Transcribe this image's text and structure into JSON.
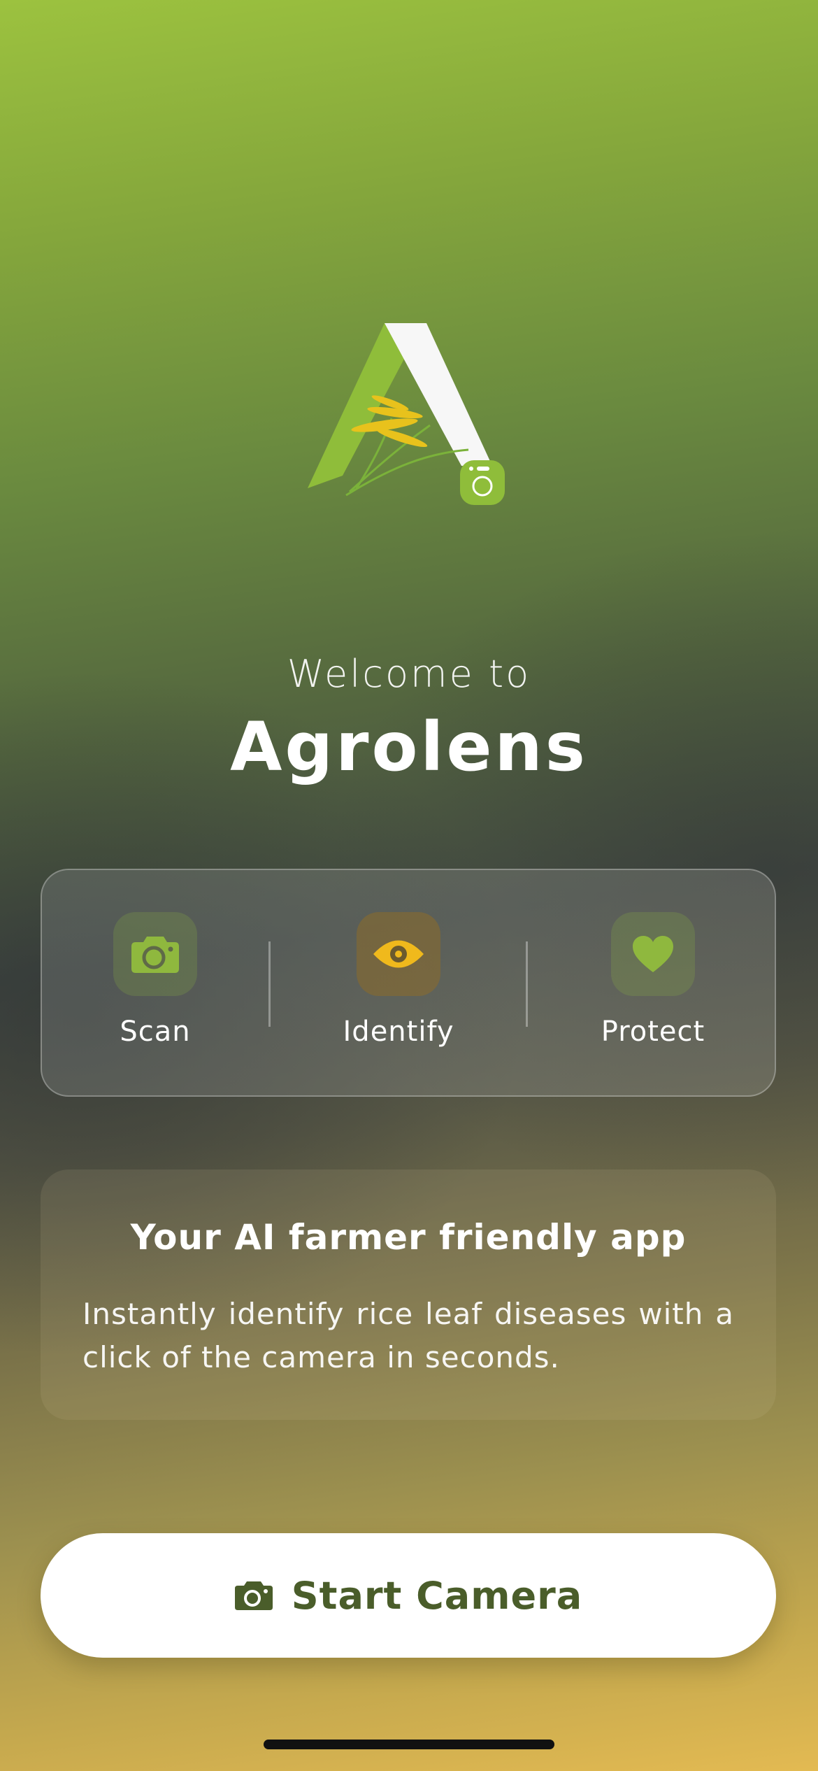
{
  "welcome": {
    "greeting": "Welcome to",
    "app_name": "Agrolens"
  },
  "features": [
    {
      "label": "Scan",
      "icon": "camera-icon",
      "color": "#8fb83e"
    },
    {
      "label": "Identify",
      "icon": "eye-icon",
      "color": "#f0b91c"
    },
    {
      "label": "Protect",
      "icon": "heart-icon",
      "color": "#8fb83e"
    }
  ],
  "info": {
    "title": "Your AI farmer friendly app",
    "description": "Instantly identify rice leaf diseases with a click of the camera in seconds."
  },
  "start_button": {
    "label": "Start Camera",
    "icon": "camera-icon"
  },
  "colors": {
    "brand_green": "#8fb83e",
    "accent_yellow": "#f0b91c",
    "button_text": "#4a5d2a"
  }
}
